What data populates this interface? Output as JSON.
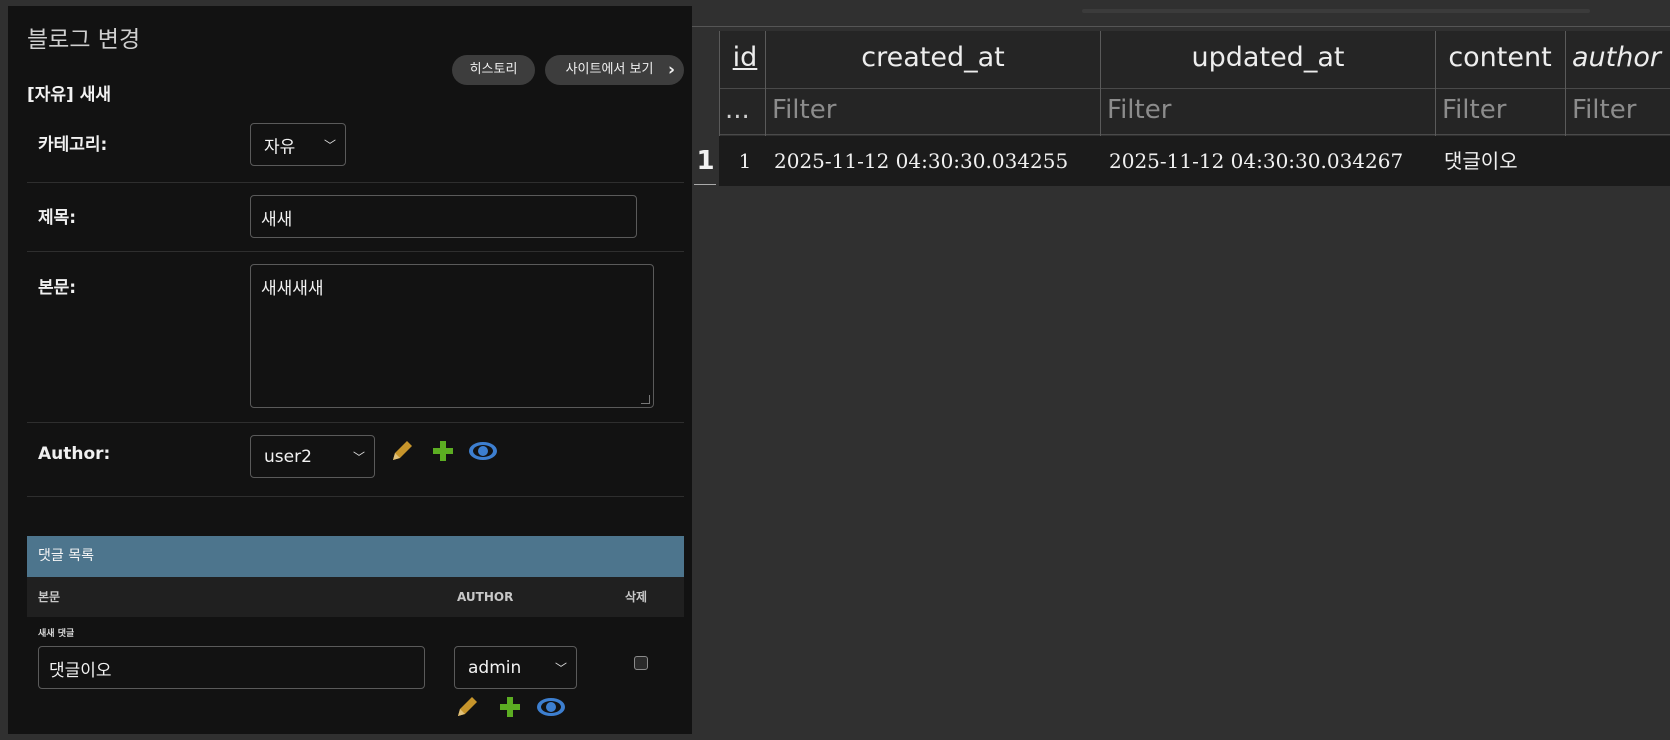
{
  "admin": {
    "page_title": "블로그 변경",
    "object_title": "[자유] 새새",
    "buttons": {
      "history": "히스토리",
      "view_on_site": "사이트에서 보기"
    },
    "fields": {
      "category": {
        "label": "카테고리:",
        "value": "자유"
      },
      "title": {
        "label": "제목:",
        "value": "새새"
      },
      "body": {
        "label": "본문:",
        "value": "새새새새"
      },
      "author": {
        "label": "Author:",
        "value": "user2"
      }
    },
    "inline": {
      "header": "댓글 목록",
      "columns": {
        "body": "본문",
        "author": "AUTHOR",
        "delete": "삭제"
      },
      "rows": [
        {
          "title": "새새 댓글",
          "content": "댓글이오",
          "author": "admin"
        }
      ]
    },
    "icons": {
      "edit": "pencil-icon",
      "add": "plus-icon",
      "view": "eye-icon"
    },
    "colors": {
      "pencil": "#c7952b",
      "plus": "#5cad22",
      "eye": "#3d7fd0",
      "inline_header": "#4d758d"
    }
  },
  "grid": {
    "columns": [
      {
        "name": "id",
        "filter": "..."
      },
      {
        "name": "created_at",
        "filter": "Filter"
      },
      {
        "name": "updated_at",
        "filter": "Filter"
      },
      {
        "name": "content",
        "filter": "Filter"
      },
      {
        "name": "author",
        "filter": "Filter"
      }
    ],
    "rows": [
      {
        "rownum": "1",
        "id": "1",
        "created_at": "2025-11-12 04:30:30.034255",
        "updated_at": "2025-11-12 04:30:30.034267",
        "content": "댓글이오",
        "author": ""
      }
    ]
  }
}
